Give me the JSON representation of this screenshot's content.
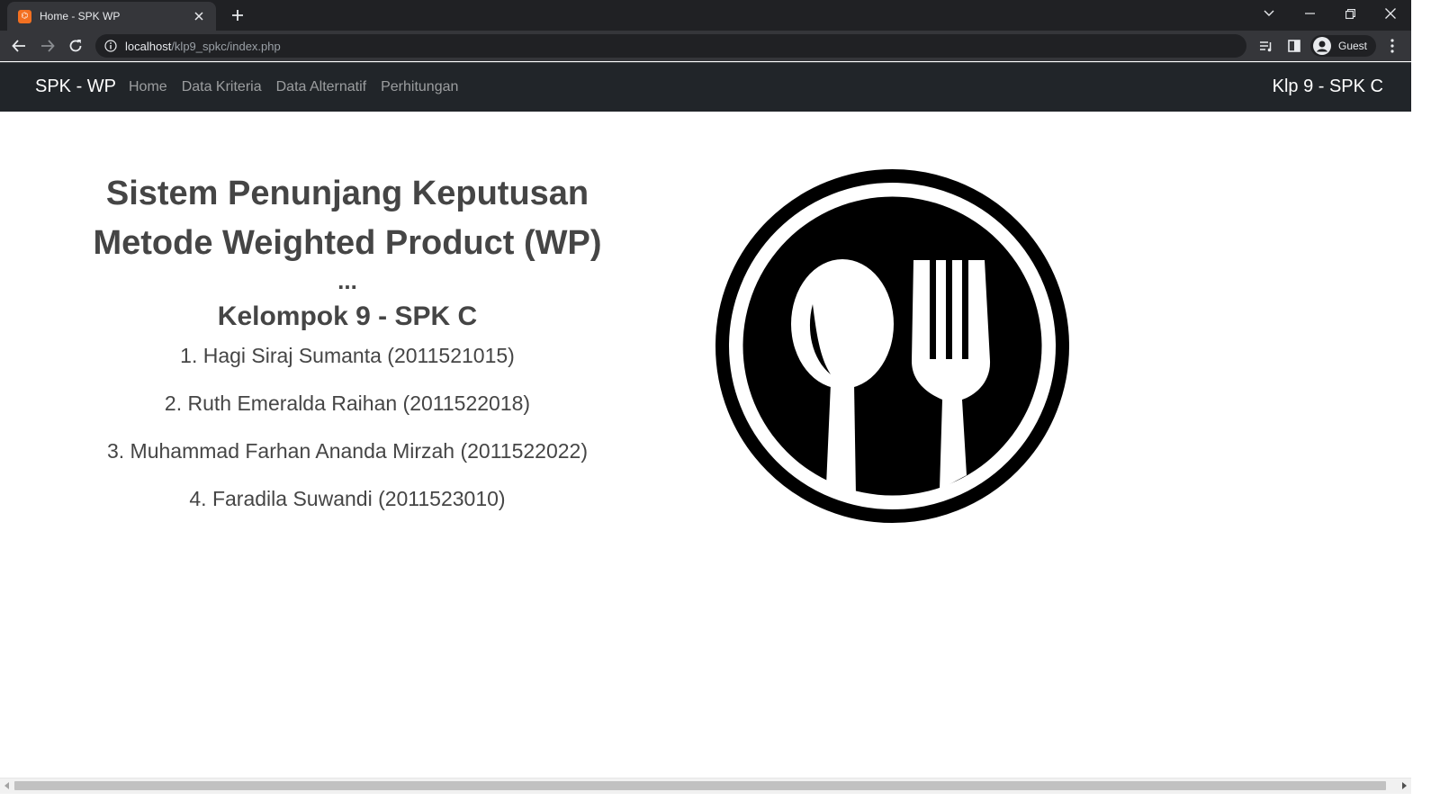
{
  "browser": {
    "tab_title": "Home - SPK WP",
    "favicon_glyph": "⌬",
    "url_host": "localhost",
    "url_path": "/klp9_spkc/index.php",
    "profile_label": "Guest",
    "accent_color": "#f37021"
  },
  "navbar": {
    "brand": "SPK - WP",
    "links": [
      "Home",
      "Data Kriteria",
      "Data Alternatif",
      "Perhitungan"
    ],
    "right_text": "Klp 9 - SPK C"
  },
  "main": {
    "title_line1": "Sistem Penunjang Keputusan",
    "title_line2": "Metode Weighted Product (WP)",
    "ellipsis": "...",
    "group_title": "Kelompok 9 - SPK C",
    "members": [
      "1. Hagi Siraj Sumanta (2011521015)",
      "2. Ruth Emeralda Raihan (2011522018)",
      "3. Muhammad Farhan Ananda Mirzah (2011522022)",
      "4. Faradila Suwandi (2011523010)"
    ],
    "logo_icon": "plate-spoon-fork-icon"
  }
}
